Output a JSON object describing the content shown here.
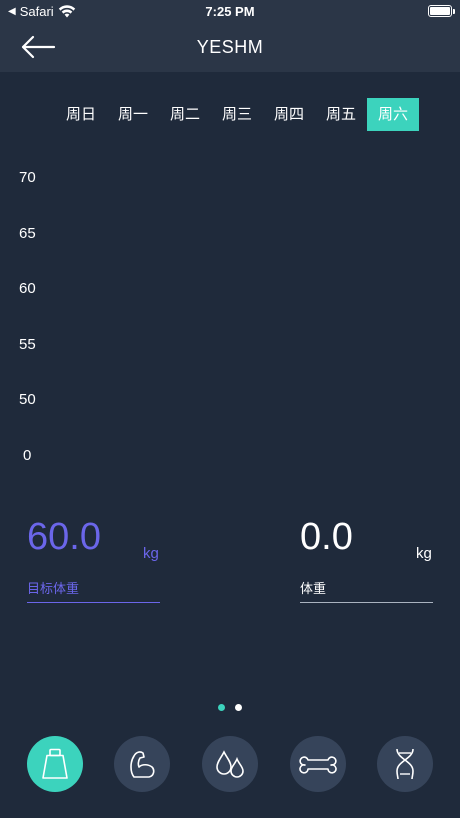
{
  "status": {
    "carrier": "Safari",
    "time": "7:25 PM"
  },
  "header": {
    "title": "YESHM"
  },
  "days": [
    {
      "label": "周日",
      "active": false
    },
    {
      "label": "周一",
      "active": false
    },
    {
      "label": "周二",
      "active": false
    },
    {
      "label": "周三",
      "active": false
    },
    {
      "label": "周四",
      "active": false
    },
    {
      "label": "周五",
      "active": false
    },
    {
      "label": "周六",
      "active": true
    }
  ],
  "chart_data": {
    "type": "line",
    "categories": [
      "周日",
      "周一",
      "周二",
      "周三",
      "周四",
      "周五",
      "周六"
    ],
    "y_ticks": [
      "70",
      "65",
      "60",
      "55",
      "50",
      "0"
    ],
    "series": []
  },
  "target_weight": {
    "value": "60.0",
    "unit": "kg",
    "label": "目标体重",
    "color": "#6b66ea"
  },
  "weight": {
    "value": "0.0",
    "unit": "kg",
    "label": "体重",
    "color": "#ffffff"
  },
  "pager": {
    "count": 2,
    "active": 0,
    "active_color": "#3cd3bd"
  },
  "tab_icons": [
    "weight-icon",
    "muscle-icon",
    "water-drops-icon",
    "bone-icon",
    "dna-icon"
  ],
  "colors": {
    "background": "#1f2a3b",
    "bar": "#2b3647",
    "accent": "#3cd3bd",
    "icon_bg": "#36445a"
  }
}
